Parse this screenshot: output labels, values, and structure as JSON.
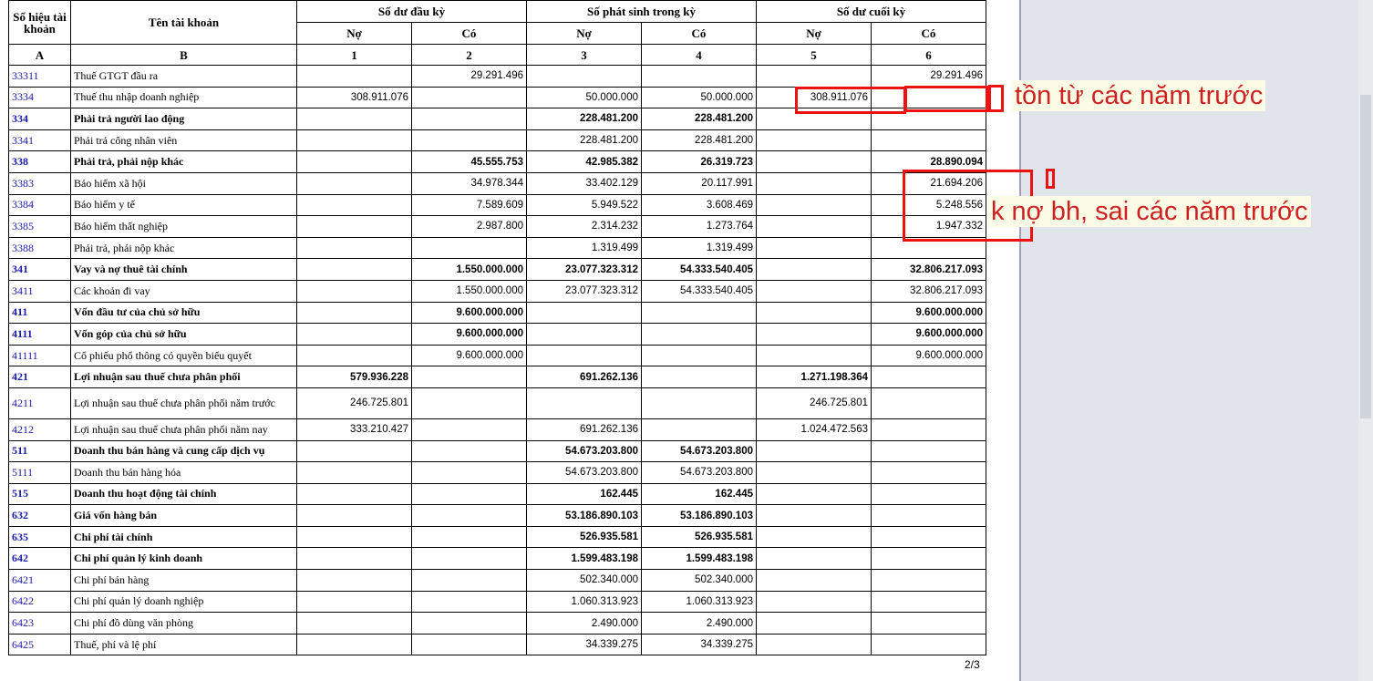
{
  "header": {
    "col_code": "Số hiệu tài khoản",
    "col_name": "Tên tài khoản",
    "opening": "Số dư đầu kỳ",
    "movement": "Số phát sinh trong kỳ",
    "closing": "Số dư cuối kỳ",
    "debit": "Nợ",
    "credit": "Có",
    "idx": [
      "A",
      "B",
      "1",
      "2",
      "3",
      "4",
      "5",
      "6"
    ]
  },
  "rows": [
    {
      "code": "33311",
      "name": "Thuế GTGT đầu ra",
      "bold": false,
      "v": [
        "",
        "29.291.496",
        "",
        "",
        "",
        "29.291.496"
      ]
    },
    {
      "code": "3334",
      "name": "Thuế thu nhập doanh nghiệp",
      "bold": false,
      "v": [
        "308.911.076",
        "",
        "50.000.000",
        "50.000.000",
        "308.911.076",
        ""
      ]
    },
    {
      "code": "334",
      "name": "Phải trả người lao động",
      "bold": true,
      "v": [
        "",
        "",
        "228.481.200",
        "228.481.200",
        "",
        ""
      ]
    },
    {
      "code": "3341",
      "name": "Phải trả công nhân viên",
      "bold": false,
      "v": [
        "",
        "",
        "228.481.200",
        "228.481.200",
        "",
        ""
      ]
    },
    {
      "code": "338",
      "name": "Phải trả, phải nộp khác",
      "bold": true,
      "v": [
        "",
        "45.555.753",
        "42.985.382",
        "26.319.723",
        "",
        "28.890.094"
      ]
    },
    {
      "code": "3383",
      "name": "Bảo hiểm xã hội",
      "bold": false,
      "v": [
        "",
        "34.978.344",
        "33.402.129",
        "20.117.991",
        "",
        "21.694.206"
      ]
    },
    {
      "code": "3384",
      "name": "Bảo hiểm y tế",
      "bold": false,
      "v": [
        "",
        "7.589.609",
        "5.949.522",
        "3.608.469",
        "",
        "5.248.556"
      ]
    },
    {
      "code": "3385",
      "name": "Bảo hiểm thất nghiệp",
      "bold": false,
      "v": [
        "",
        "2.987.800",
        "2.314.232",
        "1.273.764",
        "",
        "1.947.332"
      ]
    },
    {
      "code": "3388",
      "name": "Phải trả, phải nộp khác",
      "bold": false,
      "v": [
        "",
        "",
        "1.319.499",
        "1.319.499",
        "",
        ""
      ]
    },
    {
      "code": "341",
      "name": "Vay và nợ thuê tài chính",
      "bold": true,
      "v": [
        "",
        "1.550.000.000",
        "23.077.323.312",
        "54.333.540.405",
        "",
        "32.806.217.093"
      ]
    },
    {
      "code": "3411",
      "name": "Các khoản đi vay",
      "bold": false,
      "v": [
        "",
        "1.550.000.000",
        "23.077.323.312",
        "54.333.540.405",
        "",
        "32.806.217.093"
      ]
    },
    {
      "code": "411",
      "name": "Vốn đầu tư của chủ sở hữu",
      "bold": true,
      "v": [
        "",
        "9.600.000.000",
        "",
        "",
        "",
        "9.600.000.000"
      ]
    },
    {
      "code": "4111",
      "name": "Vốn góp của chủ sở hữu",
      "bold": true,
      "v": [
        "",
        "9.600.000.000",
        "",
        "",
        "",
        "9.600.000.000"
      ]
    },
    {
      "code": "41111",
      "name": "Cổ phiếu phổ thông có quyền biểu quyết",
      "bold": false,
      "v": [
        "",
        "9.600.000.000",
        "",
        "",
        "",
        "9.600.000.000"
      ]
    },
    {
      "code": "421",
      "name": "Lợi nhuận sau thuế chưa phân phối",
      "bold": true,
      "v": [
        "579.936.228",
        "",
        "691.262.136",
        "",
        "1.271.198.364",
        ""
      ]
    },
    {
      "code": "4211",
      "name": "Lợi nhuận sau thuế chưa phân phối năm trước",
      "bold": false,
      "tall": true,
      "v": [
        "246.725.801",
        "",
        "",
        "",
        "246.725.801",
        ""
      ]
    },
    {
      "code": "4212",
      "name": "Lợi nhuận sau thuế chưa phân phối năm nay",
      "bold": false,
      "v": [
        "333.210.427",
        "",
        "691.262.136",
        "",
        "1.024.472.563",
        ""
      ]
    },
    {
      "code": "511",
      "name": "Doanh thu bán hàng và cung cấp dịch vụ",
      "bold": true,
      "v": [
        "",
        "",
        "54.673.203.800",
        "54.673.203.800",
        "",
        ""
      ]
    },
    {
      "code": "5111",
      "name": "Doanh thu bán hàng hóa",
      "bold": false,
      "v": [
        "",
        "",
        "54.673.203.800",
        "54.673.203.800",
        "",
        ""
      ]
    },
    {
      "code": "515",
      "name": "Doanh thu hoạt động tài chính",
      "bold": true,
      "v": [
        "",
        "",
        "162.445",
        "162.445",
        "",
        ""
      ]
    },
    {
      "code": "632",
      "name": "Giá vốn hàng bán",
      "bold": true,
      "v": [
        "",
        "",
        "53.186.890.103",
        "53.186.890.103",
        "",
        ""
      ]
    },
    {
      "code": "635",
      "name": "Chi phí tài chính",
      "bold": true,
      "v": [
        "",
        "",
        "526.935.581",
        "526.935.581",
        "",
        ""
      ]
    },
    {
      "code": "642",
      "name": "Chi phí quản lý kinh doanh",
      "bold": true,
      "v": [
        "",
        "",
        "1.599.483.198",
        "1.599.483.198",
        "",
        ""
      ]
    },
    {
      "code": "6421",
      "name": "Chi phí bán hàng",
      "bold": false,
      "v": [
        "",
        "",
        "502.340.000",
        "502.340.000",
        "",
        ""
      ]
    },
    {
      "code": "6422",
      "name": "Chi phí quản lý doanh nghiệp",
      "bold": false,
      "v": [
        "",
        "",
        "1.060.313.923",
        "1.060.313.923",
        "",
        ""
      ]
    },
    {
      "code": "6423",
      "name": "Chi phí đồ dùng văn phòng",
      "bold": false,
      "v": [
        "",
        "",
        "2.490.000",
        "2.490.000",
        "",
        ""
      ]
    },
    {
      "code": "6425",
      "name": "Thuế, phí và lệ phí",
      "bold": false,
      "v": [
        "",
        "",
        "34.339.275",
        "34.339.275",
        "",
        ""
      ]
    }
  ],
  "page_number": "2/3",
  "annotations": {
    "note1": "tồn từ các năm trước",
    "note2": "k nợ bh, sai các năm trước",
    "highlight_color": "#ee1111"
  }
}
